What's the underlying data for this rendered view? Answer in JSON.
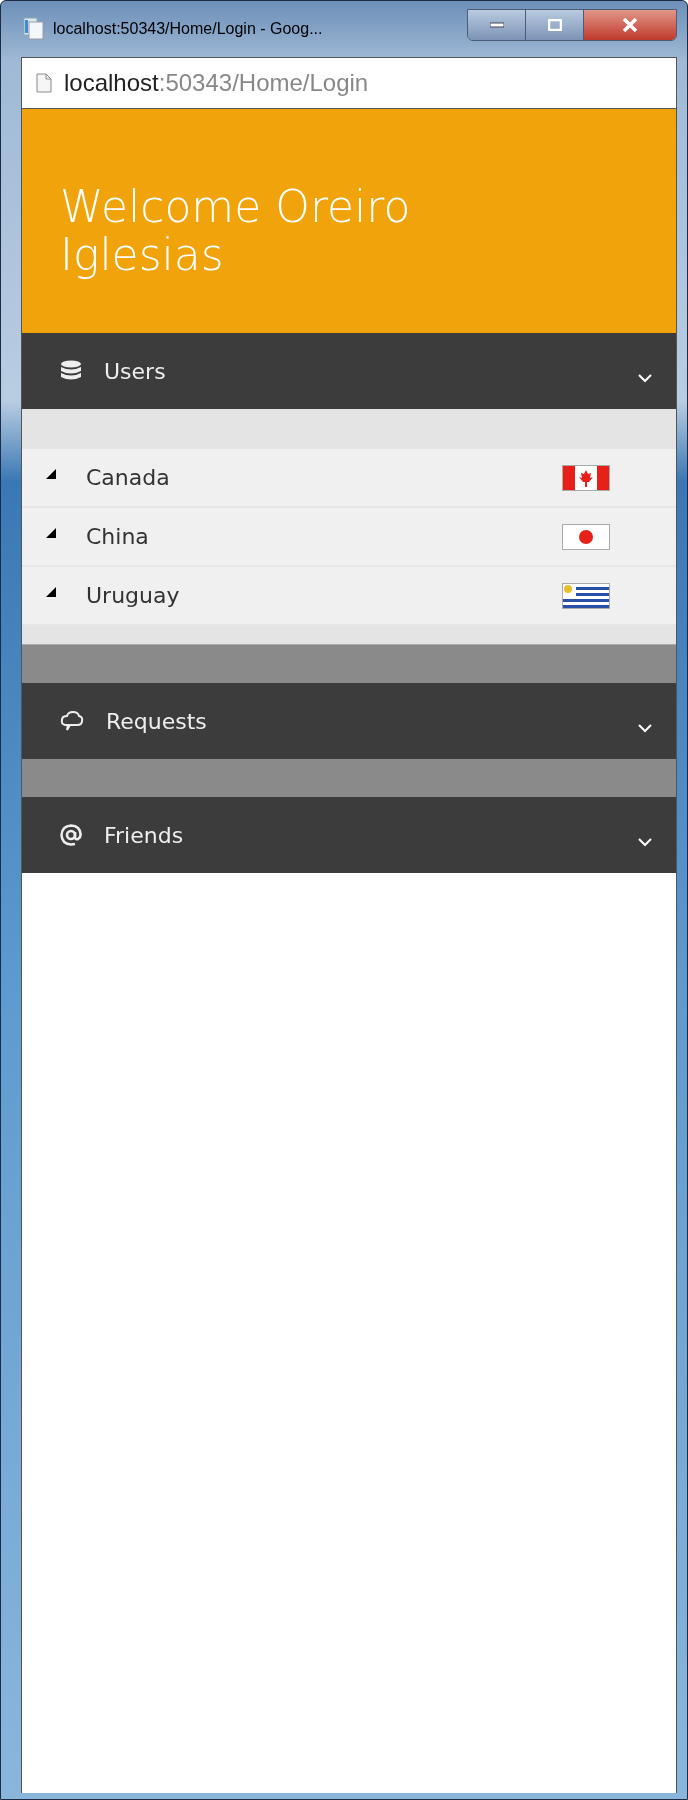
{
  "window": {
    "title": "localhost:50343/Home/Login - Goog..."
  },
  "address_bar": {
    "host": "localhost",
    "path": ":50343/Home/Login"
  },
  "header": {
    "title": "Welcome Oreiro Iglesias"
  },
  "sections": [
    {
      "label": "Users",
      "kind": "database",
      "items": [
        {
          "label": "Canada",
          "kind": "leaf"
        },
        {
          "label": "China",
          "kind": "disc"
        },
        {
          "label": "Uruguay",
          "kind": "stripes"
        }
      ]
    },
    {
      "label": "Requests",
      "kind": "cloud"
    },
    {
      "label": "Friends",
      "kind": "at"
    }
  ]
}
